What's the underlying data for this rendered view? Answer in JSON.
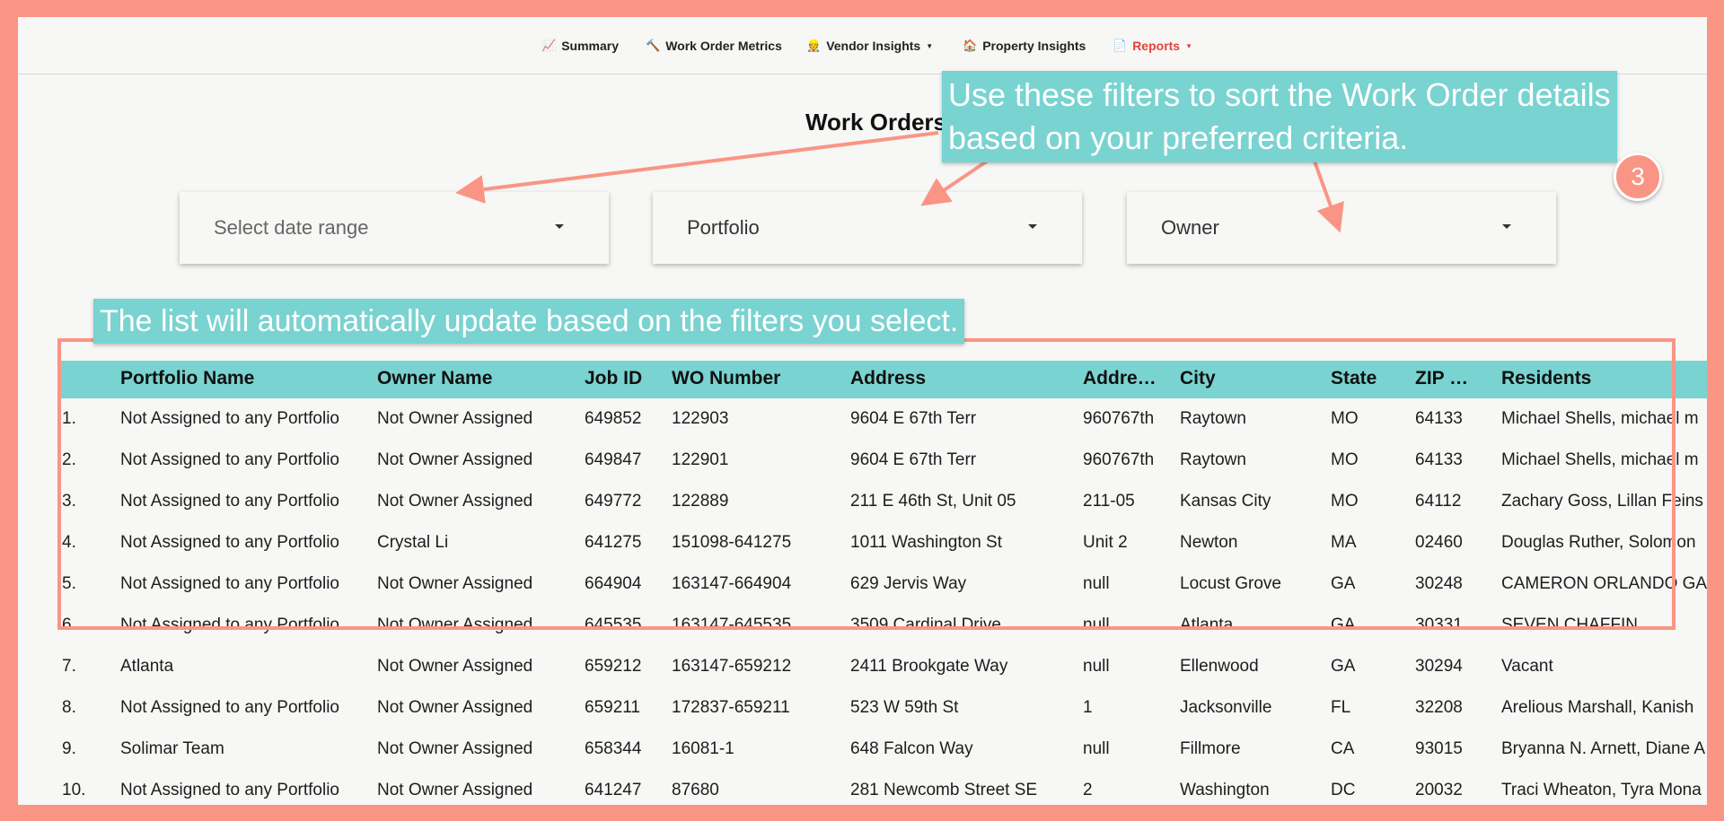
{
  "nav": {
    "items": [
      {
        "icon": "📈",
        "label": "Summary",
        "caret": false
      },
      {
        "icon": "🔨",
        "label": "Work Order Metrics",
        "caret": false
      },
      {
        "icon": "👷",
        "label": "Vendor Insights",
        "caret": true
      },
      {
        "icon": "🏠",
        "label": "Property Insights",
        "caret": false
      },
      {
        "icon": "📄",
        "label": "Reports",
        "caret": true
      }
    ],
    "active": "Reports"
  },
  "page": {
    "title": "Work Orders"
  },
  "filters": {
    "date_range": "Select date range",
    "portfolio": "Portfolio",
    "owner": "Owner"
  },
  "table": {
    "columns": [
      "",
      "Portfolio Name",
      "Owner Name",
      "Job ID",
      "WO Number",
      "Address",
      "Addre…",
      "City",
      "State",
      "ZIP …",
      "Residents"
    ],
    "rows": [
      [
        "1.",
        "Not Assigned to any Portfolio",
        "Not Owner Assigned",
        "649852",
        "122903",
        "9604 E 67th Terr",
        "960767th",
        "Raytown",
        "MO",
        "64133",
        "Michael Shells, michael m"
      ],
      [
        "2.",
        "Not Assigned to any Portfolio",
        "Not Owner Assigned",
        "649847",
        "122901",
        "9604 E 67th Terr",
        "960767th",
        "Raytown",
        "MO",
        "64133",
        "Michael Shells, michael m"
      ],
      [
        "3.",
        "Not Assigned to any Portfolio",
        "Not Owner Assigned",
        "649772",
        "122889",
        "211 E 46th St, Unit 05",
        "211-05",
        "Kansas City",
        "MO",
        "64112",
        "Zachary Goss, Lillan Feins"
      ],
      [
        "4.",
        "Not Assigned to any Portfolio",
        "Crystal Li",
        "641275",
        "151098-641275",
        "1011 Washington St",
        "Unit 2",
        "Newton",
        "MA",
        "02460",
        "Douglas Ruther, Solomon"
      ],
      [
        "5.",
        "Not Assigned to any Portfolio",
        "Not Owner Assigned",
        "664904",
        "163147-664904",
        "629 Jervis Way",
        "null",
        "Locust Grove",
        "GA",
        "30248",
        "CAMERON ORLANDO GA"
      ],
      [
        "6.",
        "Not Assigned to any Portfolio",
        "Not Owner Assigned",
        "645535",
        "163147-645535",
        "3509 Cardinal Drive",
        "null",
        "Atlanta",
        "GA",
        "30331",
        "SEVEN CHAFFIN"
      ],
      [
        "7.",
        "Atlanta",
        "Not Owner Assigned",
        "659212",
        "163147-659212",
        "2411 Brookgate Way",
        "null",
        "Ellenwood",
        "GA",
        "30294",
        "Vacant"
      ],
      [
        "8.",
        "Not Assigned to any Portfolio",
        "Not Owner Assigned",
        "659211",
        "172837-659211",
        "523 W 59th St",
        "1",
        "Jacksonville",
        "FL",
        "32208",
        "Arelious Marshall, Kanish"
      ],
      [
        "9.",
        "Solimar Team",
        "Not Owner Assigned",
        "658344",
        "16081-1",
        "648 Falcon Way",
        "null",
        "Fillmore",
        "CA",
        "93015",
        "Bryanna N. Arnett, Diane A"
      ],
      [
        "10.",
        "Not Assigned to any Portfolio",
        "Not Owner Assigned",
        "641247",
        "87680",
        "281 Newcomb Street SE",
        "2",
        "Washington",
        "DC",
        "20032",
        "Traci Wheaton, Tyra Mona"
      ]
    ]
  },
  "annotations": {
    "filters_callout_line1": "Use these filters to sort the Work Order details",
    "filters_callout_line2": "based on your preferred criteria.",
    "list_callout": "The list will automatically update based on the filters you select.",
    "step_badge": "3"
  },
  "colors": {
    "accent_teal": "#79d3d1",
    "annotation_coral": "#fa9585",
    "active_nav_red": "#e0443c"
  }
}
